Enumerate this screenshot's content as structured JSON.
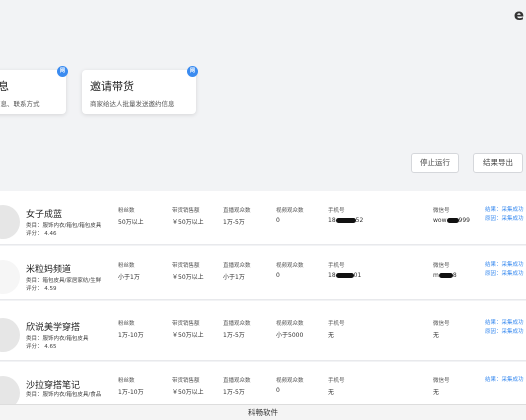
{
  "top_badge": "e",
  "cards": [
    {
      "title": "息",
      "desc": "信息、联系方式",
      "corner": "网"
    },
    {
      "title": "邀请带货",
      "desc": "商家给达人批量发送邀约信息",
      "corner": "网"
    }
  ],
  "actions": {
    "stop": "停止运行",
    "export": "结果导出"
  },
  "column_labels": {
    "fans": "粉丝数",
    "sales": "带货销售额",
    "live_viewers": "直播观众数",
    "video_viewers": "视频观众数",
    "phone": "手机号",
    "wechat": "微信号"
  },
  "rows": [
    {
      "name": "女子成蓝",
      "category": "类目：服饰内衣/箱包/箱包皮具",
      "score": "评分： 4.46",
      "fans": "50万以上",
      "sales": "￥50万以上",
      "live_viewers": "1万-5万",
      "video_viewers": "0",
      "phone_prefix": "18",
      "phone_suffix": "52",
      "wechat_prefix": "wow",
      "wechat_suffix": "999",
      "res1": "结果：采集成功",
      "res2": "原因：采集成功"
    },
    {
      "name": "米粒妈频道",
      "category": "类目：箱包皮具/家居家纺/生鲜",
      "score": "评分： 4.59",
      "fans": "小于1万",
      "sales": "￥50万以上",
      "live_viewers": "小于1万",
      "video_viewers": "0",
      "phone_prefix": "18",
      "phone_suffix": "01",
      "wechat_prefix": "m",
      "wechat_suffix": "8",
      "res1": "结果：采集成功",
      "res2": "原因：采集成功"
    },
    {
      "name": "欣说美学穿搭",
      "category": "类目：服饰内衣/箱包皮具",
      "score": "评分： 4.65",
      "fans": "1万-10万",
      "sales": "￥50万以上",
      "live_viewers": "1万-5万",
      "video_viewers": "小于5000",
      "phone": "无",
      "wechat": "无",
      "res1": "结果：采集成功",
      "res2": "原因：采集成功"
    },
    {
      "name": "沙拉穿搭笔记",
      "category": "类目：服饰内衣/箱包皮具/食品",
      "score": "",
      "fans": "1万-10万",
      "sales": "￥50万以上",
      "live_viewers": "1万-5万",
      "video_viewers": "0",
      "phone": "无",
      "wechat": "无",
      "res1": "结果：采集成功",
      "res2": ""
    }
  ],
  "footer": "科畅软件"
}
